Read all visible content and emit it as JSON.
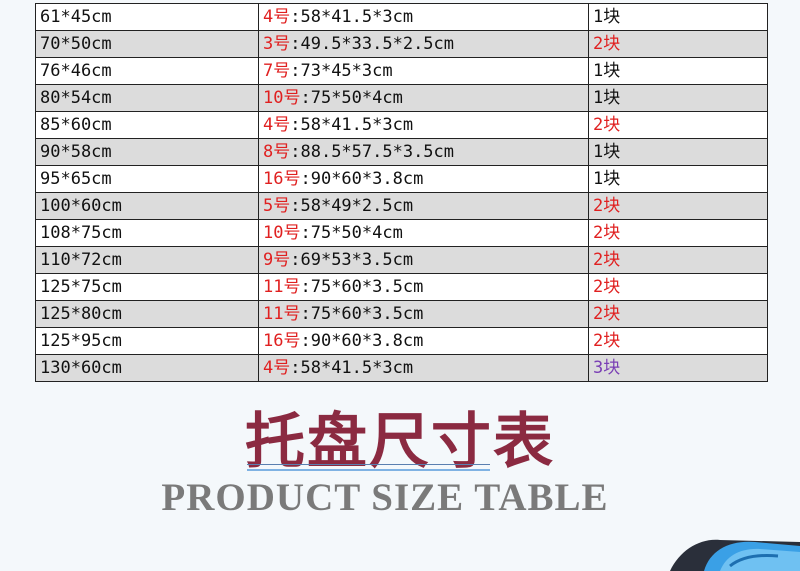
{
  "table": {
    "rows": [
      {
        "size": "61*45cm",
        "pallet_no": "4号",
        "pallet_dim": ":58*41.5*3cm",
        "qty": "1块",
        "qty_color": "dark"
      },
      {
        "size": "70*50cm",
        "pallet_no": "3号",
        "pallet_dim": ":49.5*33.5*2.5cm",
        "qty": "2块",
        "qty_color": "red"
      },
      {
        "size": "76*46cm",
        "pallet_no": "7号",
        "pallet_dim": ":73*45*3cm",
        "qty": "1块",
        "qty_color": "dark"
      },
      {
        "size": "80*54cm",
        "pallet_no": "10号",
        "pallet_dim": ":75*50*4cm",
        "qty": "1块",
        "qty_color": "dark"
      },
      {
        "size": "85*60cm",
        "pallet_no": "4号",
        "pallet_dim": ":58*41.5*3cm",
        "qty": "2块",
        "qty_color": "red"
      },
      {
        "size": "90*58cm",
        "pallet_no": "8号",
        "pallet_dim": ":88.5*57.5*3.5cm",
        "qty": "1块",
        "qty_color": "dark"
      },
      {
        "size": "95*65cm",
        "pallet_no": "16号",
        "pallet_dim": ":90*60*3.8cm",
        "qty": "1块",
        "qty_color": "dark"
      },
      {
        "size": "100*60cm",
        "pallet_no": "5号",
        "pallet_dim": ":58*49*2.5cm",
        "qty": "2块",
        "qty_color": "red"
      },
      {
        "size": "108*75cm",
        "pallet_no": "10号",
        "pallet_dim": ":75*50*4cm",
        "qty": "2块",
        "qty_color": "red"
      },
      {
        "size": "110*72cm",
        "pallet_no": "9号",
        "pallet_dim": ":69*53*3.5cm",
        "qty": "2块",
        "qty_color": "red"
      },
      {
        "size": "125*75cm",
        "pallet_no": "11号",
        "pallet_dim": ":75*60*3.5cm",
        "qty": "2块",
        "qty_color": "red"
      },
      {
        "size": "125*80cm",
        "pallet_no": "11号",
        "pallet_dim": ":75*60*3.5cm",
        "qty": "2块",
        "qty_color": "red"
      },
      {
        "size": "125*95cm",
        "pallet_no": "16号",
        "pallet_dim": ":90*60*3.8cm",
        "qty": "2块",
        "qty_color": "red"
      },
      {
        "size": "130*60cm",
        "pallet_no": "4号",
        "pallet_dim": ":58*41.5*3cm",
        "qty": "3块",
        "qty_color": "purple"
      }
    ]
  },
  "heading": {
    "title_cn": "托盘尺寸表",
    "title_en": "PRODUCT SIZE TABLE"
  },
  "colors": {
    "title_cn": "#8b2a41",
    "title_en": "#7a7a7a",
    "highlight_red": "#e02020",
    "highlight_purple": "#7a3fb5",
    "row_alt_gray": "#dcdcdc",
    "decor_blue": "#3aa0e6"
  }
}
